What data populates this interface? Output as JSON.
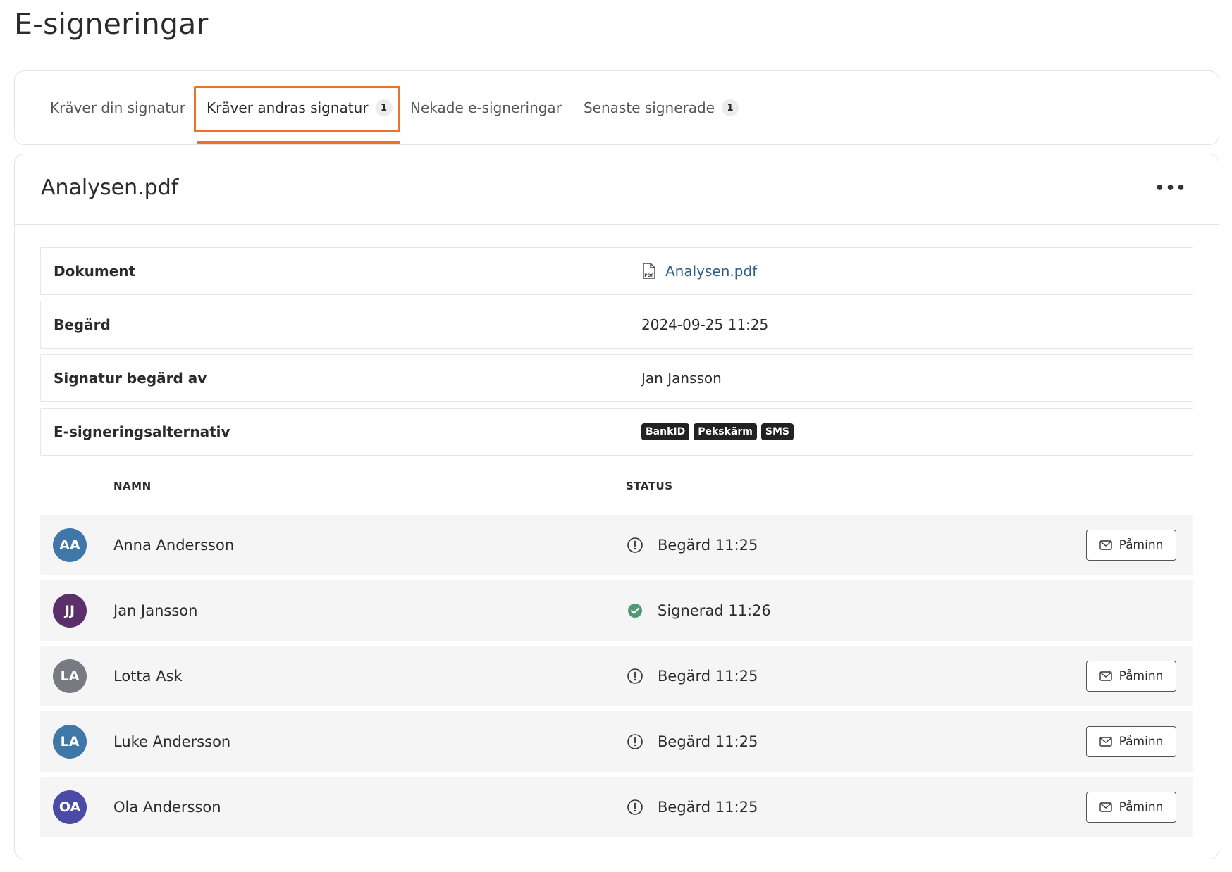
{
  "page": {
    "title": "E-signeringar"
  },
  "tabs": [
    {
      "label": "Kräver din signatur",
      "badge": "",
      "active": false
    },
    {
      "label": "Kräver andras signatur",
      "badge": "1",
      "active": true
    },
    {
      "label": "Nekade e-signeringar",
      "badge": "",
      "active": false
    },
    {
      "label": "Senaste signerade",
      "badge": "1",
      "active": false
    }
  ],
  "card": {
    "title": "Analysen.pdf",
    "more_label": "•••"
  },
  "info": {
    "document": {
      "label": "Dokument",
      "value": "Analysen.pdf",
      "icon": "pdf-file-icon"
    },
    "requested": {
      "label": "Begärd",
      "value": "2024-09-25 11:25"
    },
    "requested_by": {
      "label": "Signatur begärd av",
      "value": "Jan Jansson"
    },
    "options": {
      "label": "E-signeringsalternativ",
      "chips": [
        "BankID",
        "Pekskärm",
        "SMS"
      ]
    }
  },
  "table": {
    "headers": {
      "name": "NAMN",
      "status": "STATUS"
    },
    "remind_label": "Påminn",
    "rows": [
      {
        "initials": "AA",
        "avatar_color": "#3f78a8",
        "name": "Anna Andersson",
        "status": "Begärd 11:25",
        "state": "pending"
      },
      {
        "initials": "JJ",
        "avatar_color": "#5a2f6a",
        "name": "Jan Jansson",
        "status": "Signerad 11:26",
        "state": "signed"
      },
      {
        "initials": "LA",
        "avatar_color": "#777a80",
        "name": "Lotta Ask",
        "status": "Begärd 11:25",
        "state": "pending"
      },
      {
        "initials": "LA",
        "avatar_color": "#3f78a8",
        "name": "Luke Andersson",
        "status": "Begärd 11:25",
        "state": "pending"
      },
      {
        "initials": "OA",
        "avatar_color": "#4b4aa6",
        "name": "Ola Andersson",
        "status": "Begärd 11:25",
        "state": "pending"
      }
    ]
  },
  "colors": {
    "accent": "#e8732f",
    "link": "#2f5f8a",
    "signed": "#4f9a72"
  }
}
